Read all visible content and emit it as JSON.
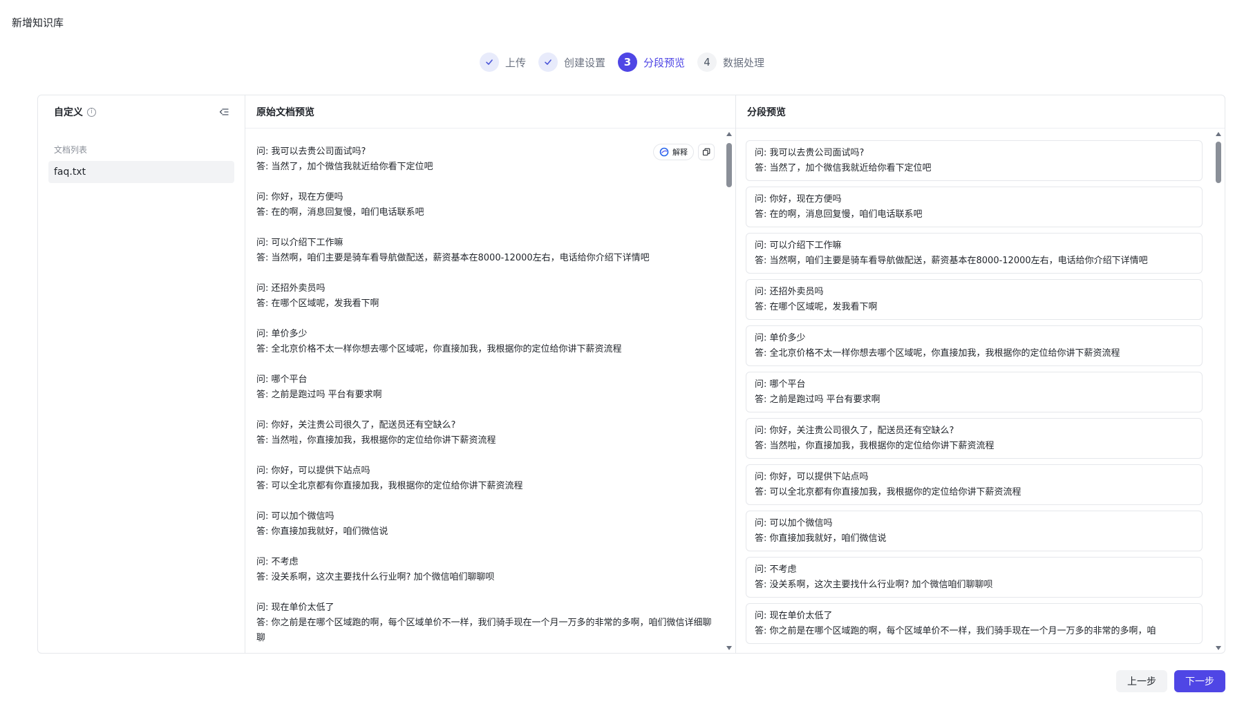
{
  "page_title": "新增知识库",
  "steps": [
    {
      "label": "上传",
      "status": "done",
      "marker": "✓"
    },
    {
      "label": "创建设置",
      "status": "done",
      "marker": "✓"
    },
    {
      "label": "分段预览",
      "status": "active",
      "marker": "3"
    },
    {
      "label": "数据处理",
      "status": "todo",
      "marker": "4"
    }
  ],
  "left_panel": {
    "title": "自定义",
    "info_glyph": "i",
    "doc_list_label": "文档列表",
    "doc_item": "faq.txt"
  },
  "middle_panel": {
    "title": "原始文档预览",
    "explain_label": "解释",
    "qa": [
      {
        "q": "问: 我可以去贵公司面试吗?",
        "a": "答: 当然了，加个微信我就近给你看下定位吧"
      },
      {
        "q": "问: 你好，现在方便吗",
        "a": "答: 在的啊，消息回复慢，咱们电话联系吧"
      },
      {
        "q": "问: 可以介绍下工作嘛",
        "a": "答: 当然啊，咱们主要是骑车看导航做配送，薪资基本在8000-12000左右，电话给你介绍下详情吧"
      },
      {
        "q": "问: 还招外卖员吗",
        "a": "答: 在哪个区域呢，发我看下啊"
      },
      {
        "q": "问: 单价多少",
        "a": "答: 全北京价格不太一样你想去哪个区域呢，你直接加我，我根据你的定位给你讲下薪资流程"
      },
      {
        "q": "问: 哪个平台",
        "a": "答: 之前是跑过吗 平台有要求啊"
      },
      {
        "q": "问: 你好，关注贵公司很久了，配送员还有空缺么?",
        "a": "答: 当然啦，你直接加我，我根据你的定位给你讲下薪资流程"
      },
      {
        "q": "问: 你好，可以提供下站点吗",
        "a": "答: 可以全北京都有你直接加我，我根据你的定位给你讲下薪资流程"
      },
      {
        "q": "问: 可以加个微信吗",
        "a": "答: 你直接加我就好，咱们微信说"
      },
      {
        "q": "问: 不考虑",
        "a": "答: 没关系啊，这次主要找什么行业啊? 加个微信咱们聊聊呗"
      },
      {
        "q": "问: 现在单价太低了",
        "a": "答: 你之前是在哪个区域跑的啊，每个区域单价不一样，我们骑手现在一个月一万多的非常的多啊，咱们微信详细聊聊"
      }
    ]
  },
  "right_panel": {
    "title": "分段预览",
    "segments": [
      {
        "q": "问: 我可以去贵公司面试吗?",
        "a": "答: 当然了，加个微信我就近给你看下定位吧"
      },
      {
        "q": "问: 你好，现在方便吗",
        "a": "答: 在的啊，消息回复慢，咱们电话联系吧"
      },
      {
        "q": "问: 可以介绍下工作嘛",
        "a": "答: 当然啊，咱们主要是骑车看导航做配送，薪资基本在8000-12000左右，电话给你介绍下详情吧"
      },
      {
        "q": "问: 还招外卖员吗",
        "a": "答: 在哪个区域呢，发我看下啊"
      },
      {
        "q": "问: 单价多少",
        "a": "答: 全北京价格不太一样你想去哪个区域呢，你直接加我，我根据你的定位给你讲下薪资流程"
      },
      {
        "q": "问: 哪个平台",
        "a": "答: 之前是跑过吗 平台有要求啊"
      },
      {
        "q": "问: 你好，关注贵公司很久了，配送员还有空缺么?",
        "a": "答: 当然啦，你直接加我，我根据你的定位给你讲下薪资流程"
      },
      {
        "q": "问: 你好，可以提供下站点吗",
        "a": "答: 可以全北京都有你直接加我，我根据你的定位给你讲下薪资流程"
      },
      {
        "q": "问: 可以加个微信吗",
        "a": "答: 你直接加我就好，咱们微信说"
      },
      {
        "q": "问: 不考虑",
        "a": "答: 没关系啊，这次主要找什么行业啊? 加个微信咱们聊聊呗"
      },
      {
        "q": "问: 现在单价太低了",
        "a": "答: 你之前是在哪个区域跑的啊，每个区域单价不一样，我们骑手现在一个月一万多的非常的多啊，咱"
      }
    ]
  },
  "footer": {
    "prev_label": "上一步",
    "next_label": "下一步"
  },
  "colors": {
    "primary": "#4f46e5",
    "step_done_bg": "#e8ebfb",
    "border": "#e5e7eb"
  }
}
